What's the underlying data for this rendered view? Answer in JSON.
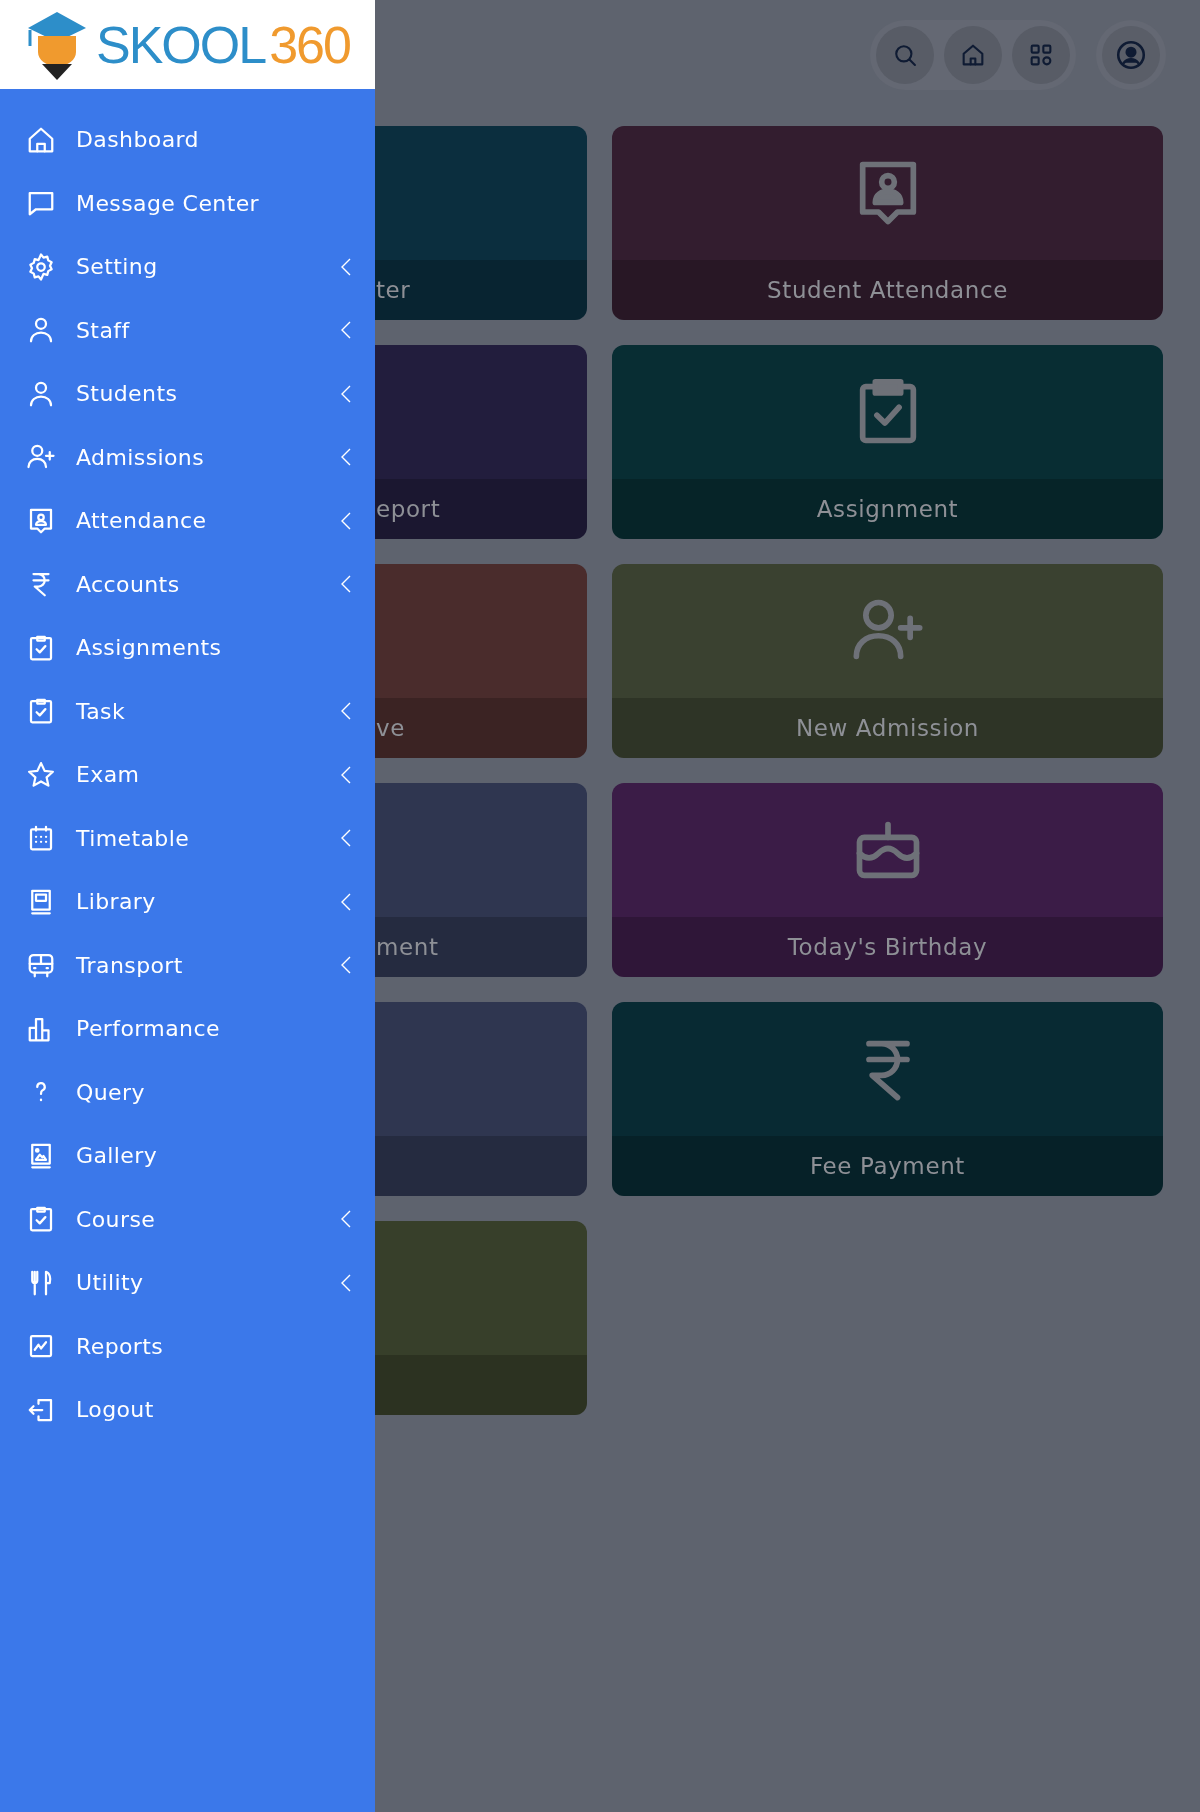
{
  "logo": {
    "word": "SKOOL",
    "number": "360"
  },
  "sidebar": {
    "items": [
      {
        "label": "Dashboard",
        "has_submenu": false
      },
      {
        "label": "Message Center",
        "has_submenu": false
      },
      {
        "label": "Setting",
        "has_submenu": true
      },
      {
        "label": "Staff",
        "has_submenu": true
      },
      {
        "label": "Students",
        "has_submenu": true
      },
      {
        "label": "Admissions",
        "has_submenu": true
      },
      {
        "label": "Attendance",
        "has_submenu": true
      },
      {
        "label": "Accounts",
        "has_submenu": true
      },
      {
        "label": "Assignments",
        "has_submenu": false
      },
      {
        "label": "Task",
        "has_submenu": true
      },
      {
        "label": "Exam",
        "has_submenu": true
      },
      {
        "label": "Timetable",
        "has_submenu": true
      },
      {
        "label": "Library",
        "has_submenu": true
      },
      {
        "label": "Transport",
        "has_submenu": true
      },
      {
        "label": "Performance",
        "has_submenu": false
      },
      {
        "label": "Query",
        "has_submenu": false
      },
      {
        "label": "Gallery",
        "has_submenu": false
      },
      {
        "label": "Course",
        "has_submenu": true
      },
      {
        "label": "Utility",
        "has_submenu": true
      },
      {
        "label": "Reports",
        "has_submenu": false
      },
      {
        "label": "Logout",
        "has_submenu": false
      }
    ]
  },
  "cards": [
    {
      "label": "ter",
      "color": "#0b2e3e"
    },
    {
      "label": "Student Attendance",
      "color": "#331d2f"
    },
    {
      "label": "eport",
      "color": "#221d3d"
    },
    {
      "label": "Assignment",
      "color": "#082d33"
    },
    {
      "label": "ve",
      "color": "#4a2c2c"
    },
    {
      "label": "New Admission",
      "color": "#3a4130"
    },
    {
      "label": "ment",
      "color": "#2f3650"
    },
    {
      "label": "Today's Birthday",
      "color": "#3b1c47"
    },
    {
      "color": "#2f3650"
    },
    {
      "label": "Fee Payment",
      "color": "#082a33"
    },
    {
      "color": "#373f2a"
    }
  ]
}
